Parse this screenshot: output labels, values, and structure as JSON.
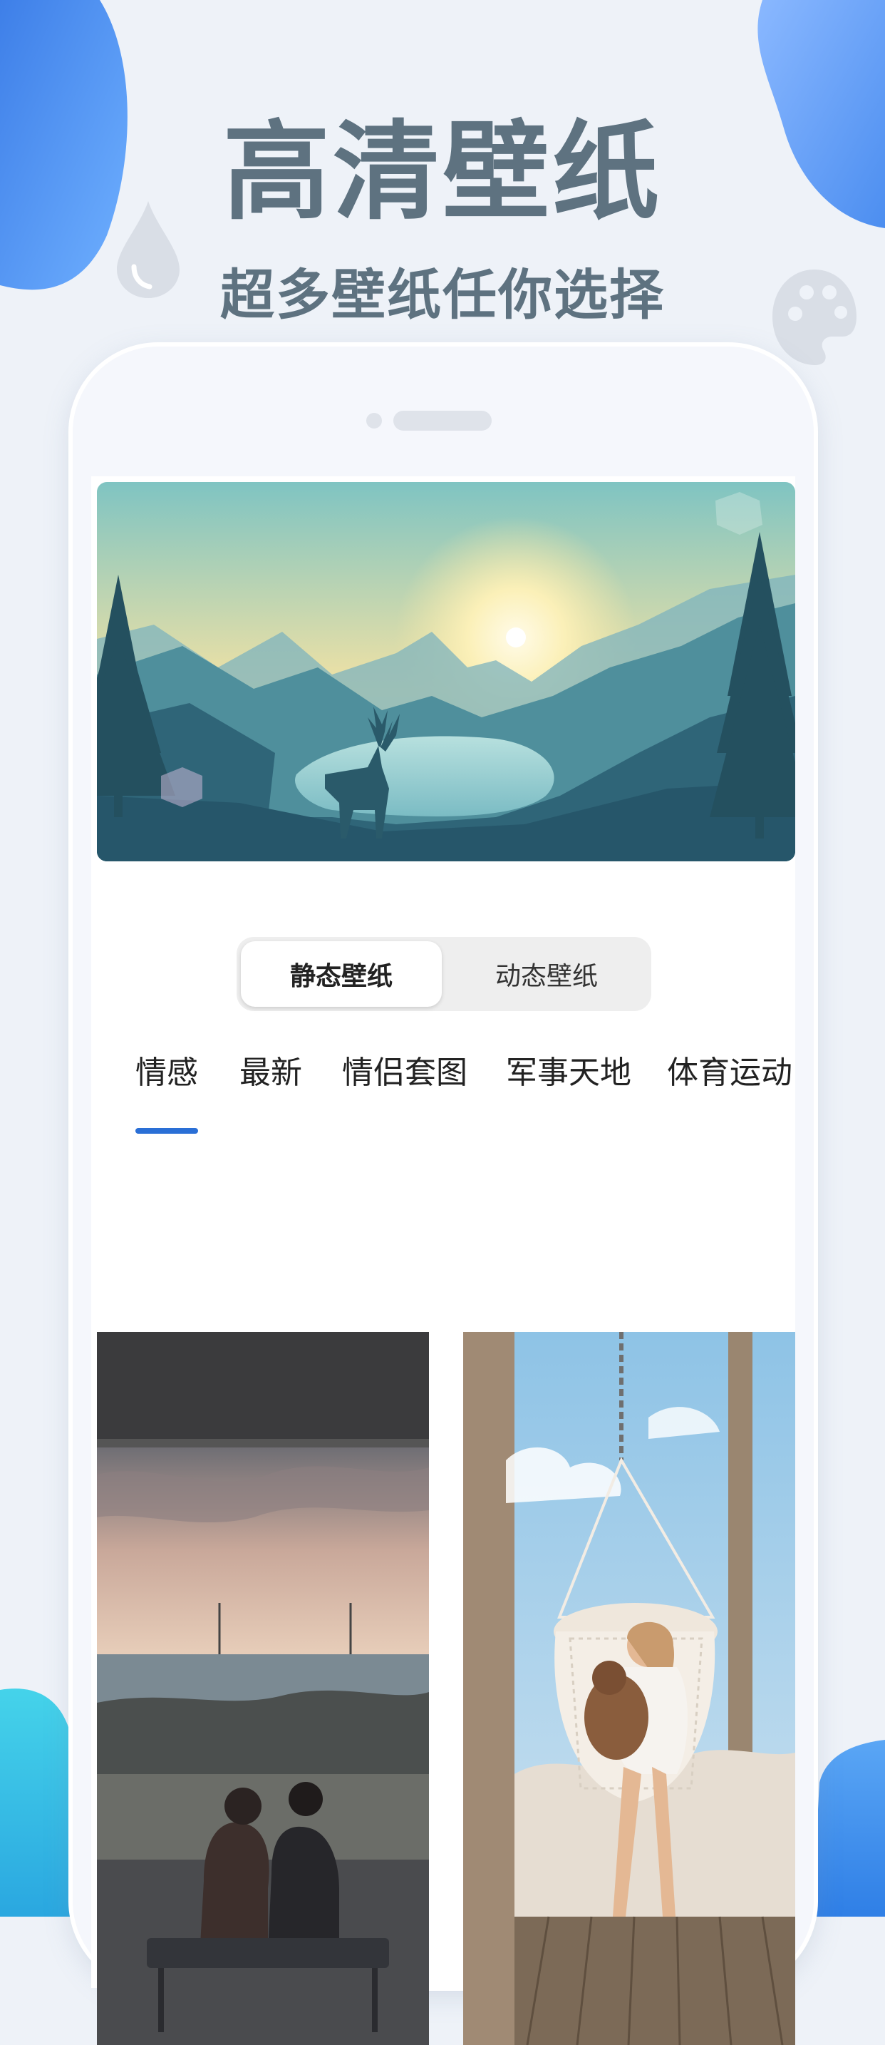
{
  "headline": "高清壁纸",
  "subheadline": "超多壁纸任你选择",
  "colors": {
    "accent": "#2a6fd6",
    "headline": "#5e7280",
    "blob_blue": "#4c8ef0",
    "blob_cyan": "#3ec6e6"
  },
  "segmented_control": {
    "static_label": "静态壁纸",
    "live_label": "动态壁纸",
    "selected": "静态壁纸"
  },
  "categories": [
    {
      "label": "情感",
      "active": true
    },
    {
      "label": "最新",
      "active": false
    },
    {
      "label": "情侣套图",
      "active": false
    },
    {
      "label": "军事天地",
      "active": false
    },
    {
      "label": "体育运动",
      "active": false
    }
  ],
  "icons": {
    "drop": "water-drop-icon",
    "palette": "palette-icon"
  }
}
